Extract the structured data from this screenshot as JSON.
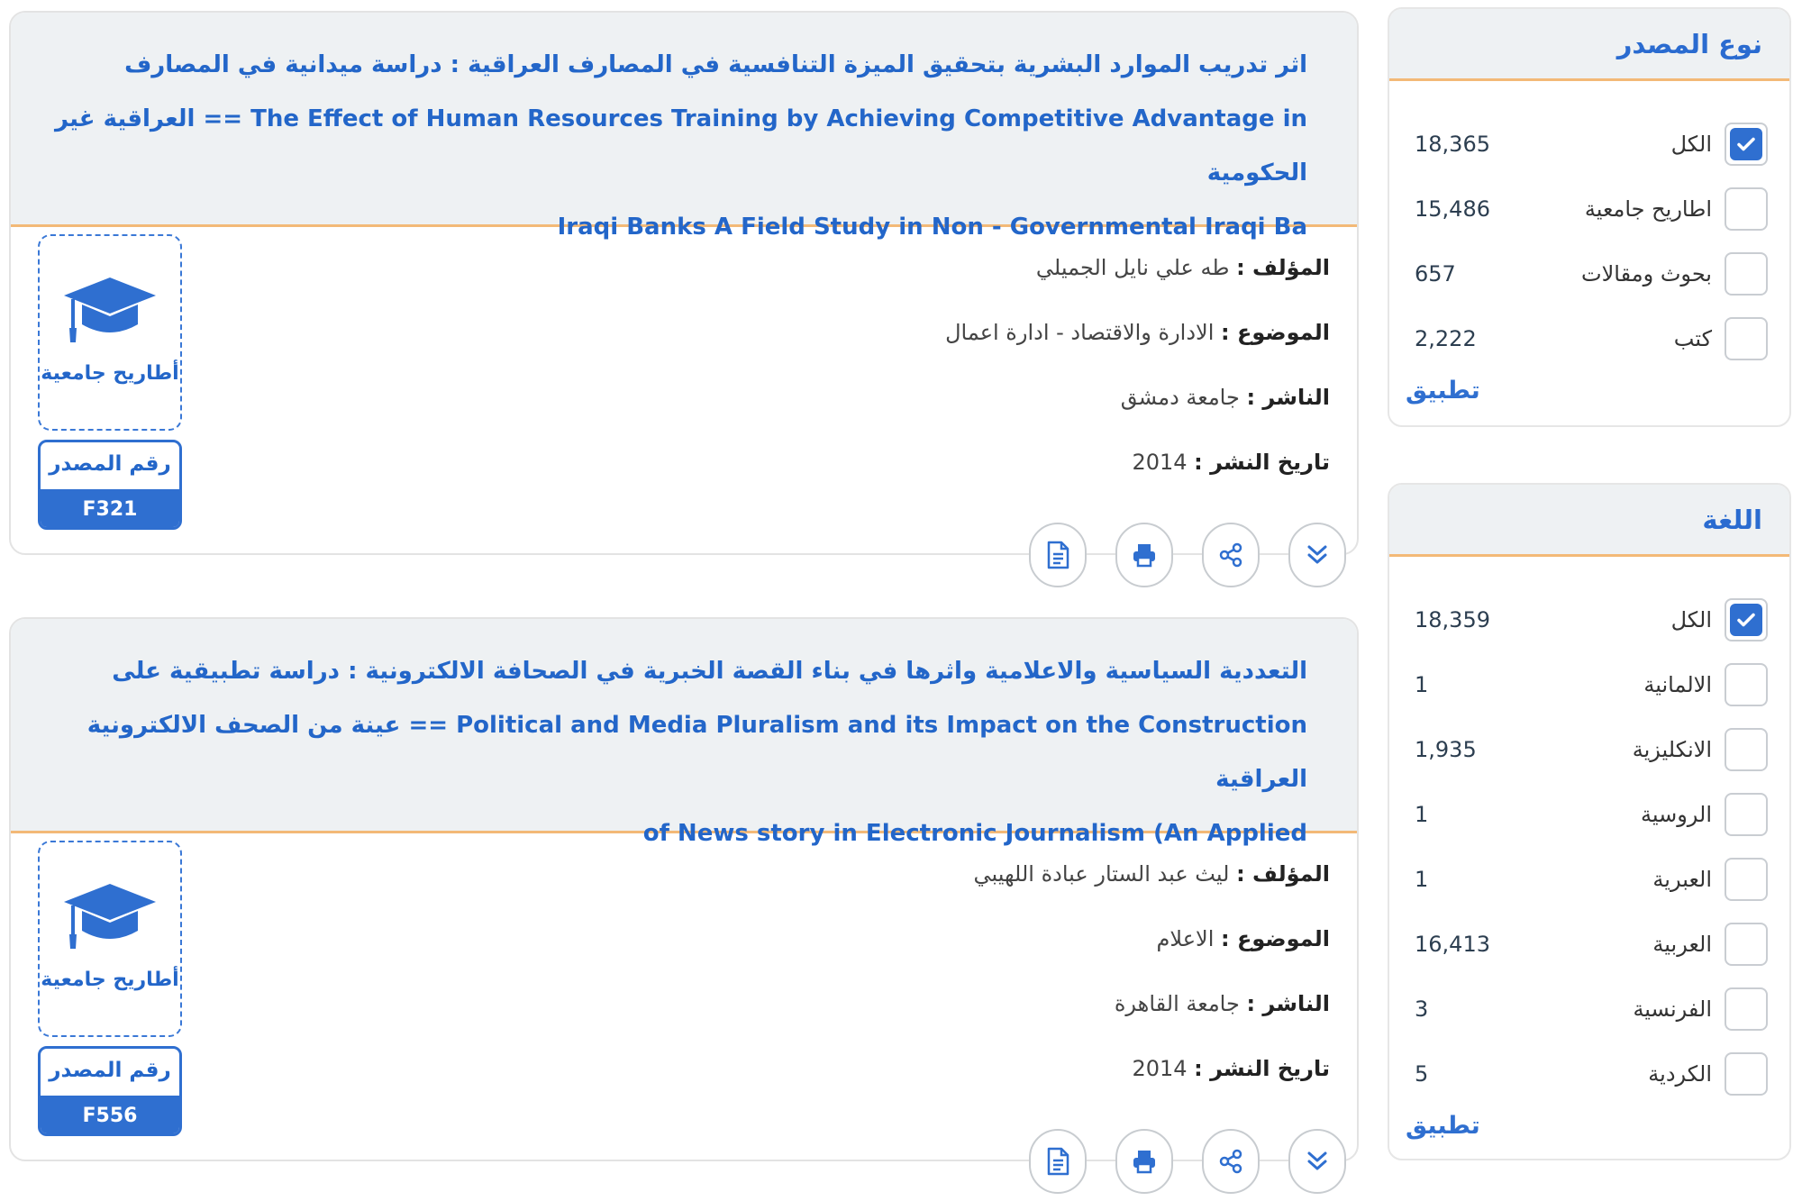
{
  "filters": {
    "source_type": {
      "title": "نوع المصدر",
      "items": [
        {
          "label": "الكل",
          "count": "18,365",
          "checked": true
        },
        {
          "label": "اطاريح جامعية",
          "count": "15,486",
          "checked": false
        },
        {
          "label": "بحوث ومقالات",
          "count": "657",
          "checked": false
        },
        {
          "label": "كتب",
          "count": "2,222",
          "checked": false
        }
      ],
      "apply_label": "تطبيق"
    },
    "language": {
      "title": "اللغة",
      "items": [
        {
          "label": "الكل",
          "count": "18,359",
          "checked": true
        },
        {
          "label": "الالمانية",
          "count": "1",
          "checked": false
        },
        {
          "label": "الانكليزية",
          "count": "1,935",
          "checked": false
        },
        {
          "label": "الروسية",
          "count": "1",
          "checked": false
        },
        {
          "label": "العبرية",
          "count": "1",
          "checked": false
        },
        {
          "label": "العربية",
          "count": "16,413",
          "checked": false
        },
        {
          "label": "الفرنسية",
          "count": "3",
          "checked": false
        },
        {
          "label": "الكردية",
          "count": "5",
          "checked": false
        }
      ],
      "apply_label": "تطبيق"
    }
  },
  "results": [
    {
      "title_lines": [
        "اثر تدريب الموارد البشرية بتحقيق الميزة التنافسية في المصارف العراقية : دراسة ميدانية في المصارف",
        "The Effect of Human Resources Training by Achieving Competitive Advantage in == العراقية غير الحكومية",
        "Iraqi Banks A Field Study in Non - Governmental Iraqi Ba"
      ],
      "author_key": "المؤلف :",
      "author": "طه علي نايل الجميلي",
      "subject_key": "الموضوع :",
      "subject": "الادارة والاقتصاد - ادارة اعمال",
      "publisher_key": "الناشر :",
      "publisher": "جامعة دمشق",
      "date_key": "تاريخ النشر :",
      "date": "2014",
      "type_label": "أطاريح جامعية",
      "source_label": "رقم المصدر",
      "source_code": "F321"
    },
    {
      "title_lines": [
        "التعددية السياسية والاعلامية واثرها في بناء القصة الخبرية في الصحافة الالكترونية : دراسة تطبيقية على",
        "Political and Media Pluralism and its Impact on the Construction == عينة من الصحف الالكترونية العراقية",
        "of News story in Electronic Journalism (An Applied"
      ],
      "author_key": "المؤلف :",
      "author": "ليث عبد الستار عبادة اللهيبي",
      "subject_key": "الموضوع :",
      "subject": "الاعلام",
      "publisher_key": "الناشر :",
      "publisher": "جامعة القاهرة",
      "date_key": "تاريخ النشر :",
      "date": "2014",
      "type_label": "أطاريح جامعية",
      "source_label": "رقم المصدر",
      "source_code": "F556"
    }
  ],
  "icons": {
    "action_buttons": [
      "document-icon",
      "print-icon",
      "share-icon",
      "expand-down-icon"
    ],
    "type_icon": "graduation-cap-icon",
    "checked_icon": "checkmark-icon"
  },
  "colors": {
    "accent": "#2f6fd0",
    "divider": "#f3b977",
    "panel_head": "#eef1f3"
  }
}
